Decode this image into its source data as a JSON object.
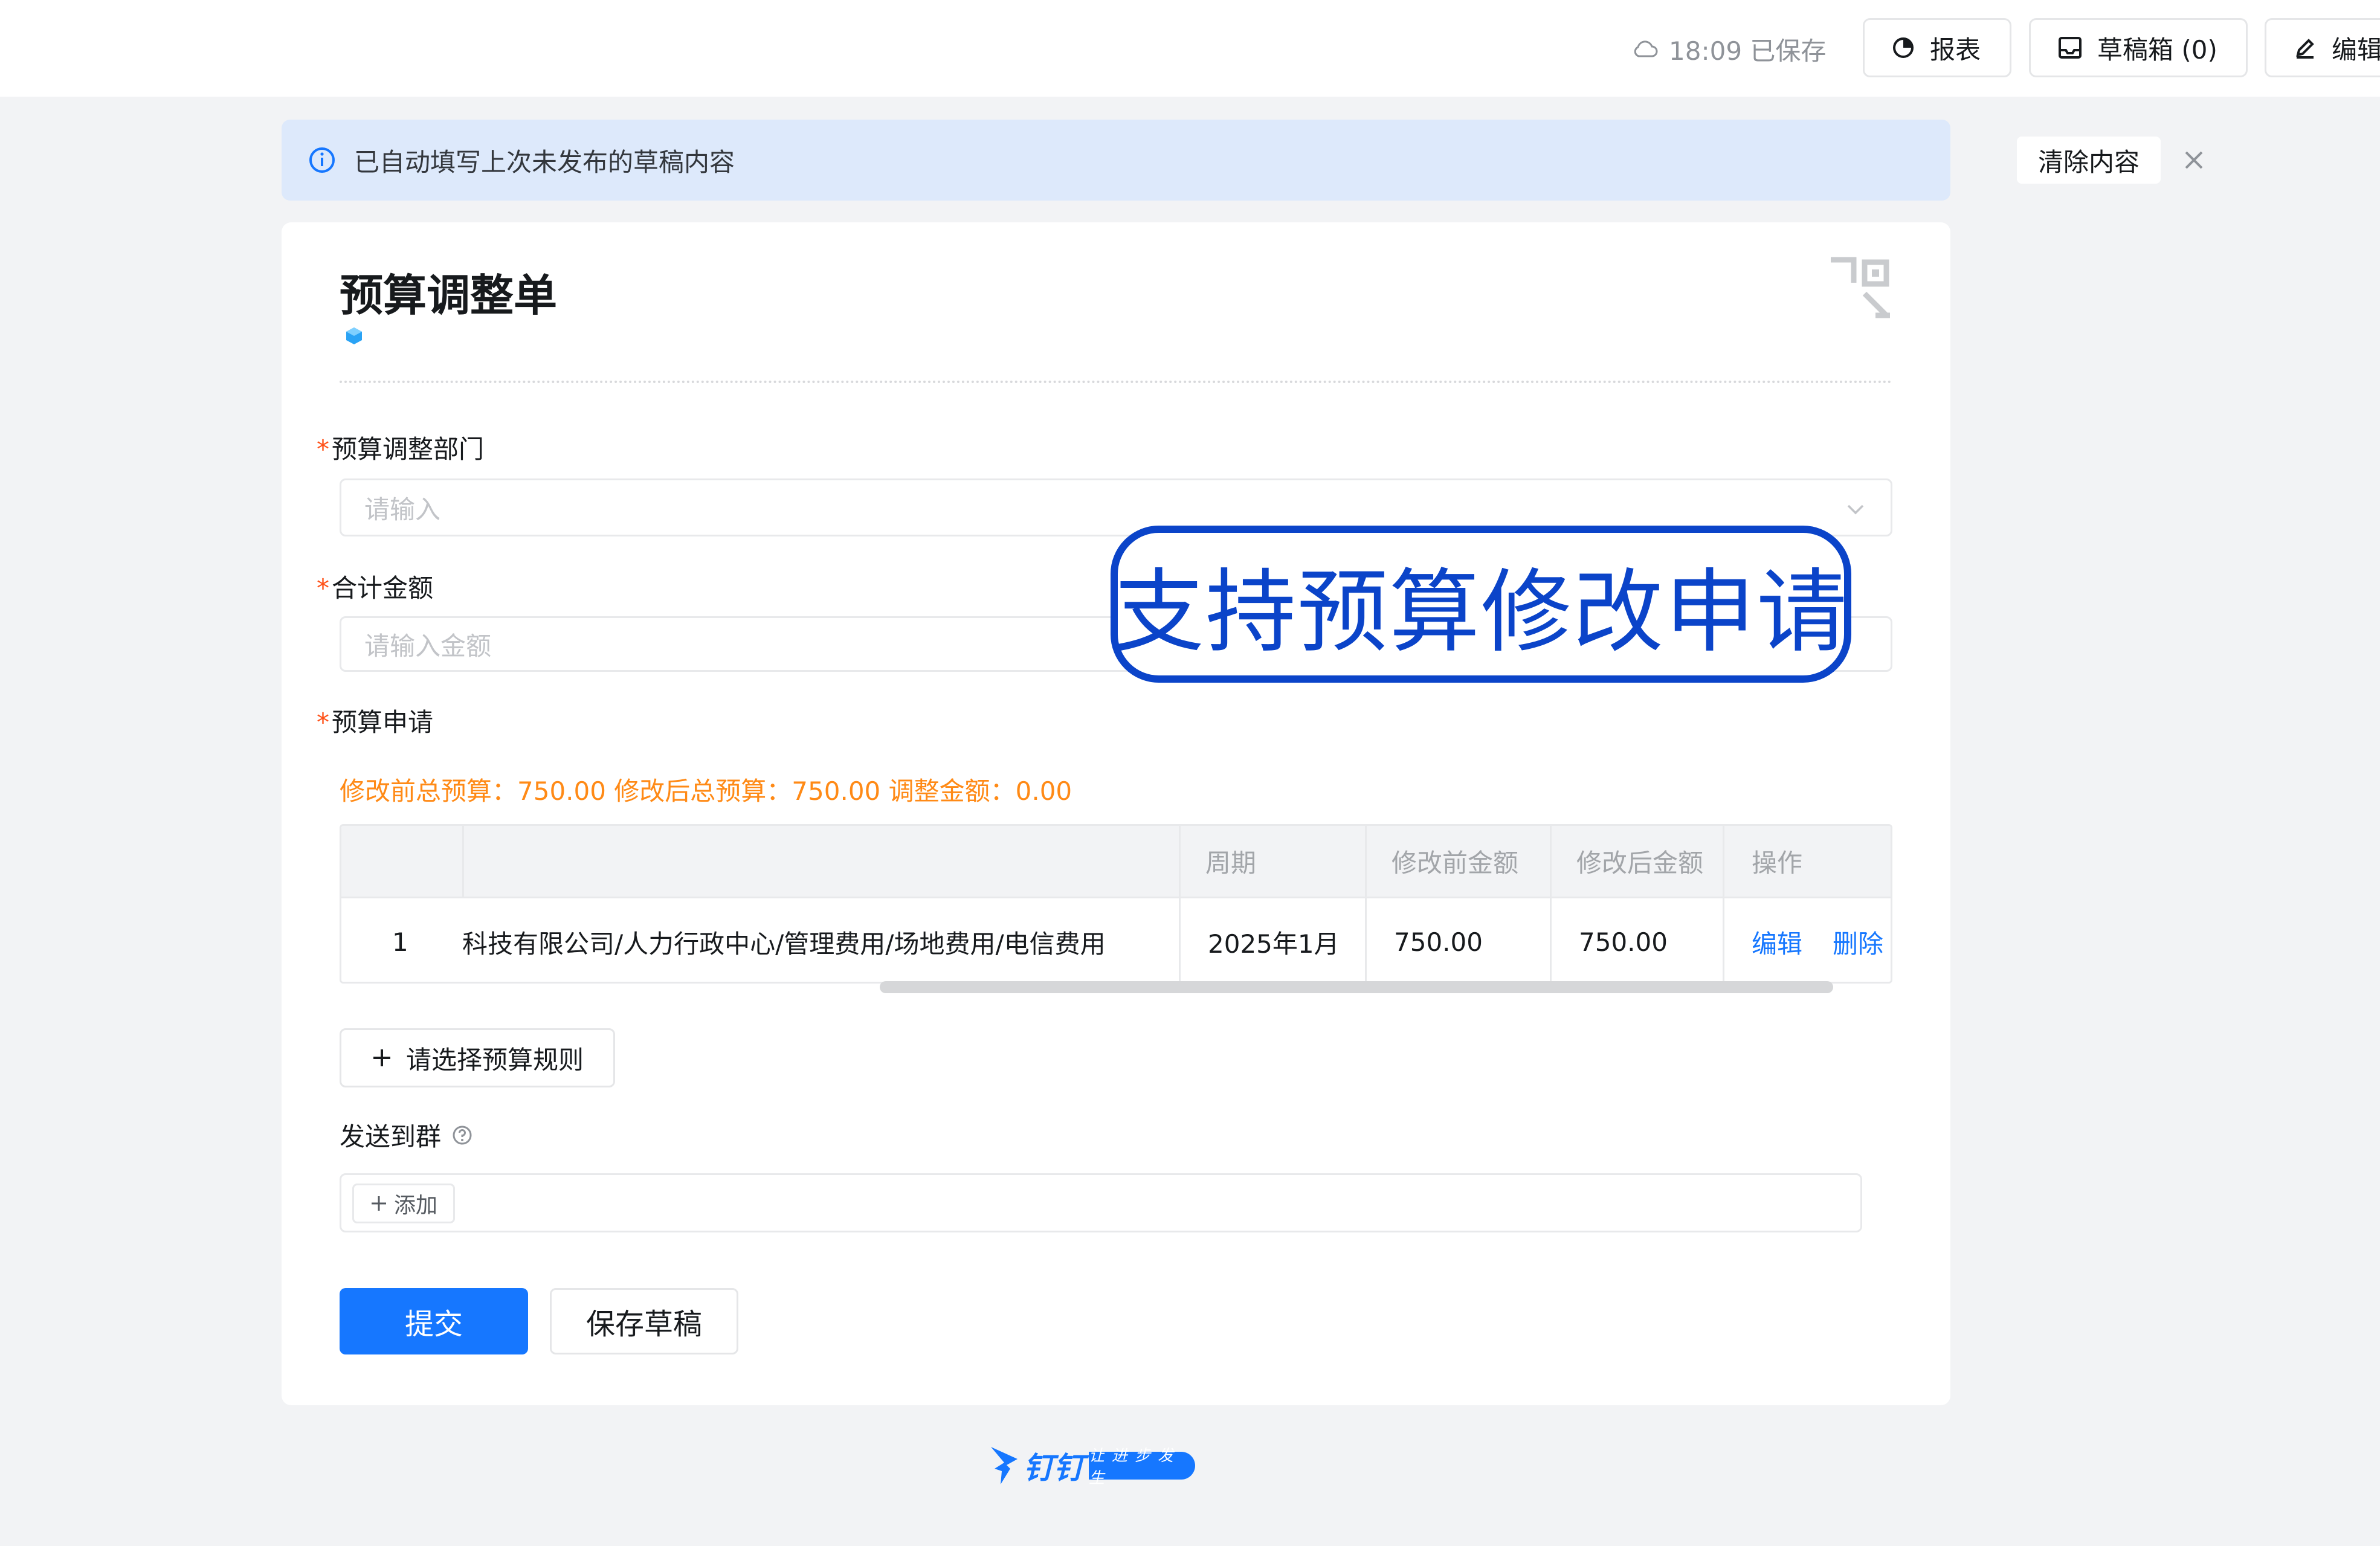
{
  "header": {
    "save_status": "18:09 已保存",
    "report_label": "报表",
    "drafts_label": "草稿箱 (0)",
    "edit_label": "编辑"
  },
  "banner": {
    "message": "已自动填写上次未发布的草稿内容",
    "clear_label": "清除内容"
  },
  "form": {
    "title": "预算调整单",
    "fields": {
      "department": {
        "label": "预算调整部门",
        "placeholder": "请输入"
      },
      "total_amount": {
        "label": "合计金额",
        "placeholder": "请输入金额"
      },
      "budget_request": {
        "label": "预算申请"
      }
    },
    "summary": "修改前总预算：750.00 修改后总预算：750.00 调整金额：0.00",
    "table": {
      "headers": [
        "",
        "",
        "周期",
        "修改前金额",
        "修改后金额",
        "操作"
      ],
      "rows": [
        {
          "index": "1",
          "item": "科技有限公司/人力行政中心/管理费用/场地费用/电信费用",
          "period": "2025年1月",
          "before": "750.00",
          "after": "750.00",
          "edit": "编辑",
          "delete": "删除"
        }
      ]
    },
    "select_rule_label": "请选择预算规则",
    "send_to_group_label": "发送到群",
    "add_label": "添加",
    "submit_label": "提交",
    "save_draft_label": "保存草稿"
  },
  "callout": {
    "text": "支持预算修改申请"
  },
  "brand": {
    "name": "钉钉",
    "slogan": "让进步发生"
  },
  "colors": {
    "primary": "#1677ff",
    "required": "#ff5219",
    "summary": "#ff8a16",
    "banner_bg": "#dde9fb",
    "callout": "#0b44c9"
  }
}
